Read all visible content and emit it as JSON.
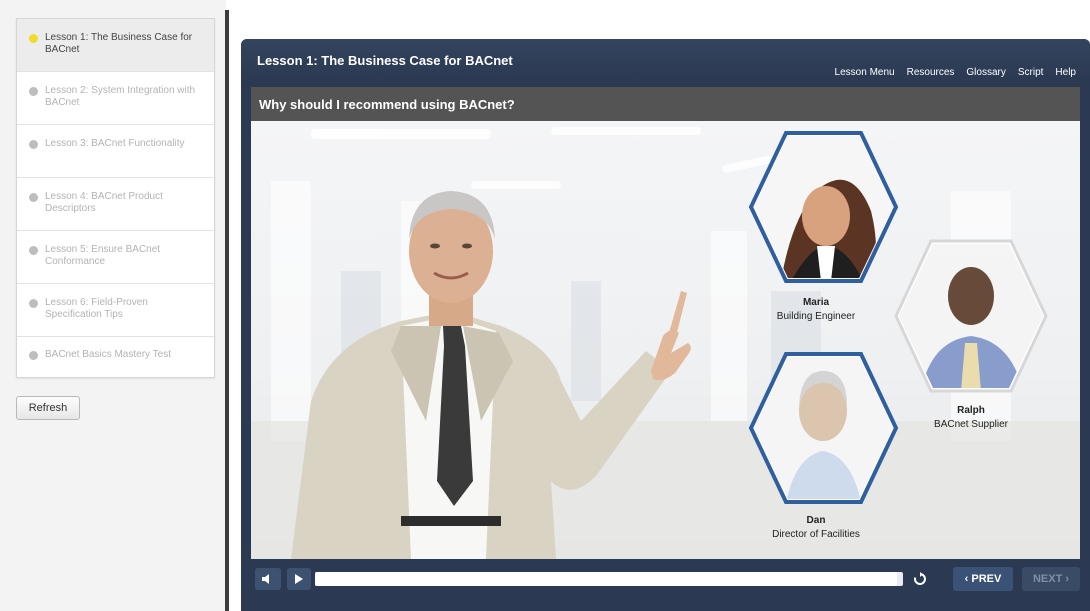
{
  "sidebar": {
    "lessons": [
      {
        "label": "Lesson 1: The Business Case for BACnet",
        "active": true
      },
      {
        "label": "Lesson 2: System Integration with BACnet",
        "active": false
      },
      {
        "label": "Lesson 3: BACnet Functionality",
        "active": false
      },
      {
        "label": "Lesson 4: BACnet Product Descriptors",
        "active": false
      },
      {
        "label": "Lesson 5: Ensure BACnet Conformance",
        "active": false
      },
      {
        "label": "Lesson 6: Field-Proven Specification Tips",
        "active": false
      },
      {
        "label": "BACnet Basics Mastery Test",
        "active": false
      }
    ],
    "refresh_label": "Refresh"
  },
  "player": {
    "lesson_title": "Lesson 1: The Business Case for BACnet",
    "nav": [
      "Lesson Menu",
      "Resources",
      "Glossary",
      "Script",
      "Help"
    ],
    "question": "Why should I recommend using BACnet?"
  },
  "characters": {
    "maria": {
      "name": "Maria",
      "role": "Building Engineer"
    },
    "ralph": {
      "name": "Ralph",
      "role": "BACnet Supplier"
    },
    "dan": {
      "name": "Dan",
      "role": "Director of Facilities"
    }
  },
  "controls": {
    "progress": 0.99,
    "prev_label": "‹ PREV",
    "next_label": "NEXT ›",
    "icons": [
      "volume-icon",
      "play-icon",
      "replay-icon"
    ]
  },
  "colors": {
    "frame": "#2b3a52",
    "question_bar": "#545454",
    "hex_border": "#2f5f9e",
    "active_dot": "#f2dc2a"
  }
}
